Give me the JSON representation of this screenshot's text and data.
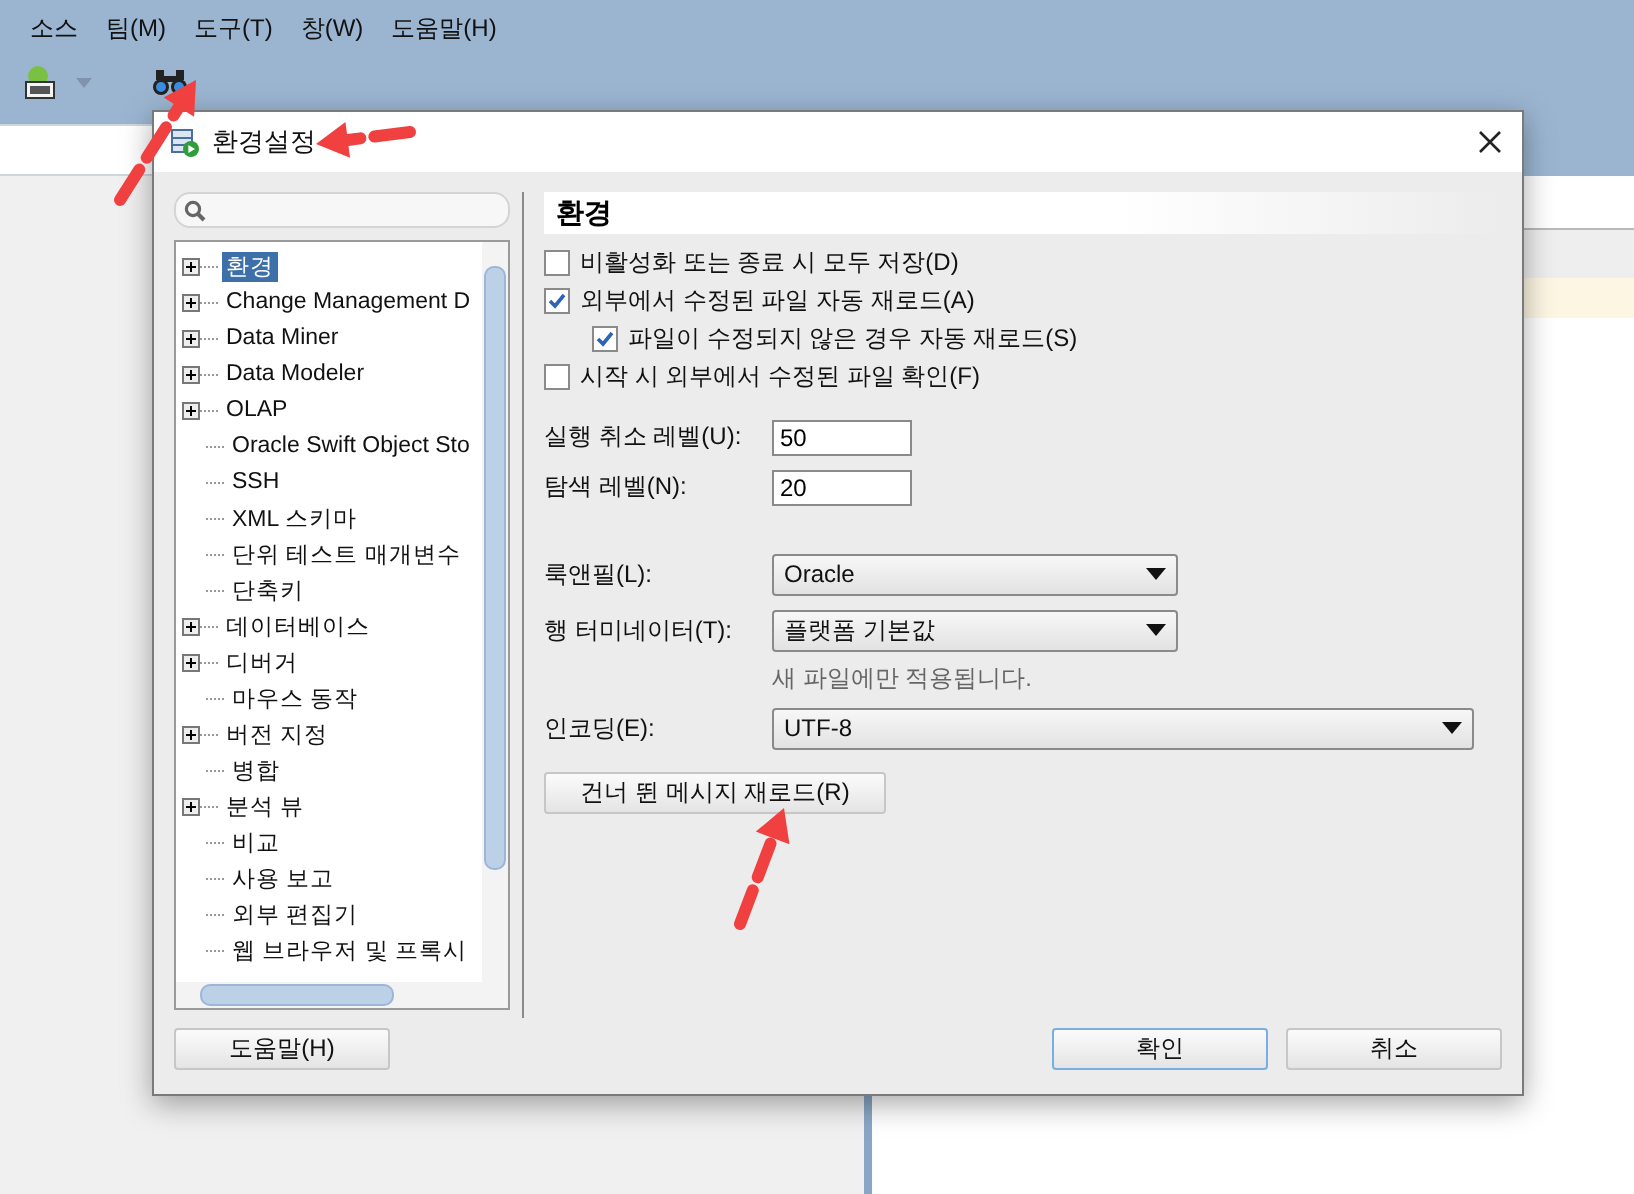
{
  "menu": [
    {
      "label": "소스"
    },
    {
      "label": "팀(M)"
    },
    {
      "label": "도구(T)"
    },
    {
      "label": "창(W)"
    },
    {
      "label": "도움말(H)"
    }
  ],
  "dialog": {
    "title": "환경설정",
    "tree": [
      {
        "label": "환경",
        "expandable": true,
        "selected": true
      },
      {
        "label": "Change Management D",
        "expandable": true,
        "selected": false
      },
      {
        "label": "Data Miner",
        "expandable": true,
        "selected": false
      },
      {
        "label": "Data Modeler",
        "expandable": true,
        "selected": false
      },
      {
        "label": "OLAP",
        "expandable": true,
        "selected": false
      },
      {
        "label": "Oracle Swift Object Sto",
        "expandable": false,
        "selected": false
      },
      {
        "label": "SSH",
        "expandable": false,
        "selected": false
      },
      {
        "label": "XML 스키마",
        "expandable": false,
        "selected": false
      },
      {
        "label": "단위 테스트 매개변수",
        "expandable": false,
        "selected": false
      },
      {
        "label": "단축키",
        "expandable": false,
        "selected": false
      },
      {
        "label": "데이터베이스",
        "expandable": true,
        "selected": false
      },
      {
        "label": "디버거",
        "expandable": true,
        "selected": false
      },
      {
        "label": "마우스 동작",
        "expandable": false,
        "selected": false
      },
      {
        "label": "버전 지정",
        "expandable": true,
        "selected": false
      },
      {
        "label": "병합",
        "expandable": false,
        "selected": false
      },
      {
        "label": "분석 뷰",
        "expandable": true,
        "selected": false
      },
      {
        "label": "비교",
        "expandable": false,
        "selected": false
      },
      {
        "label": "사용 보고",
        "expandable": false,
        "selected": false
      },
      {
        "label": "외부 편집기",
        "expandable": false,
        "selected": false
      },
      {
        "label": "웹 브라우저 및 프록시",
        "expandable": false,
        "selected": false
      }
    ],
    "heading": "환경",
    "checkboxes": [
      {
        "label": "비활성화 또는 종료 시 모두 저장(D)",
        "checked": false
      },
      {
        "label": "외부에서 수정된 파일 자동 재로드(A)",
        "checked": true,
        "children": [
          {
            "label": "파일이 수정되지 않은 경우 자동 재로드(S)",
            "checked": true
          }
        ]
      },
      {
        "label": "시작 시 외부에서 수정된 파일 확인(F)",
        "checked": false
      }
    ],
    "fields": [
      {
        "label": "실행 취소 레벨(U):",
        "value": "50"
      },
      {
        "label": "탐색 레벨(N):",
        "value": "20"
      }
    ],
    "combos": [
      {
        "label": "룩앤필(L):",
        "value": "Oracle"
      },
      {
        "label": "행 터미네이터(T):",
        "value": "플랫폼 기본값"
      }
    ],
    "hint": "새 파일에만 적용됩니다.",
    "encoding": {
      "label": "인코딩(E):",
      "value": "UTF-8"
    },
    "reset_button": "건너 뛴 메시지 재로드(R)",
    "help_button": "도움말(H)",
    "buttons": [
      {
        "label": "확인",
        "focused": true
      },
      {
        "label": "취소",
        "focused": false
      }
    ]
  }
}
